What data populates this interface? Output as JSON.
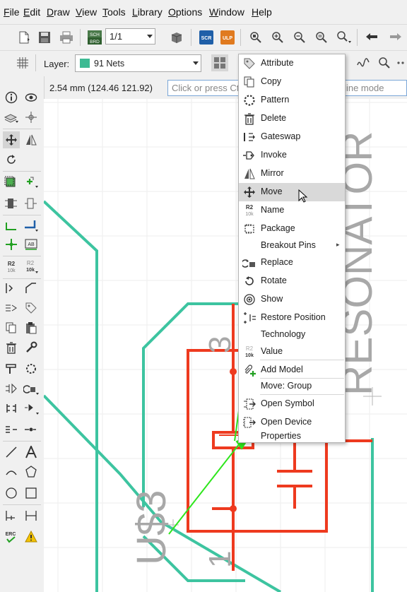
{
  "menubar": {
    "items": [
      {
        "label": "File",
        "u": "F",
        "rest": "ile"
      },
      {
        "label": "Edit",
        "u": "E",
        "rest": "dit"
      },
      {
        "label": "Draw",
        "u": "D",
        "rest": "raw"
      },
      {
        "label": "View",
        "u": "V",
        "rest": "iew"
      },
      {
        "label": "Tools",
        "u": "T",
        "rest": "ools"
      },
      {
        "label": "Library",
        "u": "L",
        "rest": "ibrary"
      },
      {
        "label": "Options",
        "u": "O",
        "rest": "ptions"
      },
      {
        "label": "Window",
        "u": "W",
        "rest": "indow"
      },
      {
        "label": "Help",
        "u": "H",
        "rest": "elp"
      }
    ]
  },
  "toolbar": {
    "sheet_select": "1/1",
    "scr_label": "SCR",
    "ulp_label": "ULP",
    "sch_brd_top": "SCH",
    "sch_brd_bottom": "BRD"
  },
  "layer_bar": {
    "layer_label": "Layer:",
    "layer_value": "91 Nets",
    "layer_color": "#3dba93"
  },
  "coord_bar": {
    "coordinates": "2.54 mm (124.46 121.92)",
    "command_placeholder": "Click or press Ctrl+L to activate command line mode"
  },
  "left_toolbar": {
    "r2_top": "R2",
    "r2_bottom": "10k",
    "ab_label": "AB",
    "erc_label": "ERC"
  },
  "context_menu": {
    "items": [
      {
        "label": "Attribute",
        "icon": "tag-icon"
      },
      {
        "label": "Copy",
        "icon": "copy-icon"
      },
      {
        "label": "Pattern",
        "icon": "pattern-icon"
      },
      {
        "label": "Delete",
        "icon": "trash-icon"
      },
      {
        "label": "Gateswap",
        "icon": "gateswap-icon"
      },
      {
        "label": "Invoke",
        "icon": "invoke-icon"
      },
      {
        "label": "Mirror",
        "icon": "mirror-icon"
      },
      {
        "label": "Move",
        "icon": "move-icon",
        "highlighted": true
      },
      {
        "label": "Name",
        "icon": "name-icon"
      },
      {
        "label": "Package",
        "icon": "package-icon"
      },
      {
        "label": "Breakout Pins",
        "icon": "",
        "submenu": true
      },
      {
        "label": "Replace",
        "icon": "replace-icon"
      },
      {
        "label": "Rotate",
        "icon": "rotate-icon"
      },
      {
        "label": "Show",
        "icon": "eye-icon"
      },
      {
        "label": "Restore Position",
        "icon": "restore-position-icon"
      },
      {
        "label": "Technology",
        "icon": ""
      },
      {
        "label": "Value",
        "icon": "value-icon"
      },
      {
        "label": "Add Model",
        "icon": "add-model-icon"
      },
      {
        "label": "Move: Group",
        "icon": ""
      },
      {
        "label": "Open Symbol",
        "icon": "open-symbol-icon"
      },
      {
        "label": "Open Device",
        "icon": "open-device-icon"
      },
      {
        "label": "Properties",
        "icon": ""
      }
    ],
    "name_icon_top": "R2",
    "name_icon_bottom": "10k",
    "value_icon_top": "R2",
    "value_icon_bottom": "10k",
    "submenu_arrow": "▸"
  },
  "schematic": {
    "label_resonator": "RESONATOR",
    "label_u3": "U$3",
    "pin_3": "3",
    "pin_1": "1",
    "net_color": "#3dc4a0",
    "part_color": "#ee3a1f",
    "text_color": "#a8a8a8",
    "arrow_color": "#2ee61c"
  }
}
